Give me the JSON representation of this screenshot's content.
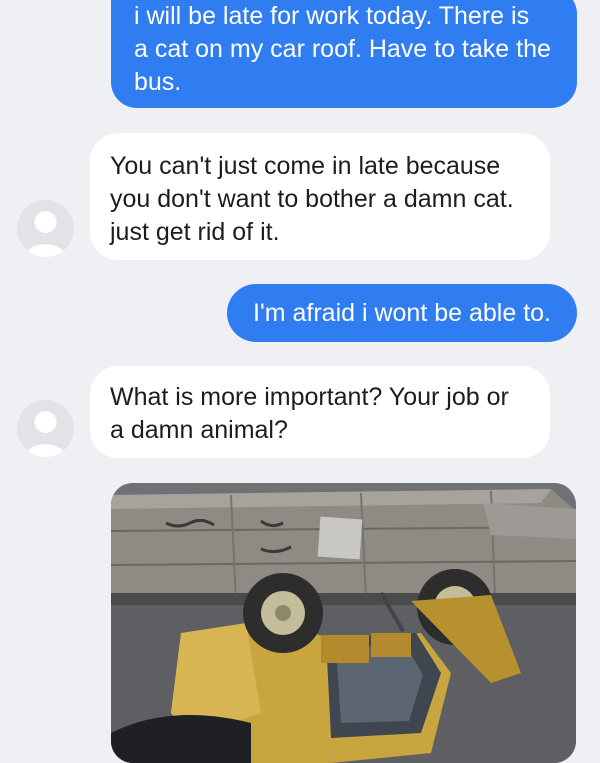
{
  "messages": [
    {
      "direction": "outgoing",
      "text": "i will be late for work today. There is\na cat on my car roof. Have to take the\nbus."
    },
    {
      "direction": "incoming",
      "text": "You can't just come in late because\nyou don't want to bother a damn cat.\njust get rid of it.",
      "avatar": "user-avatar-icon"
    },
    {
      "direction": "outgoing",
      "text": "I'm afraid i wont be able to."
    },
    {
      "direction": "incoming",
      "text": "What is more important? Your job or\na damn animal?",
      "avatar": "user-avatar-icon"
    },
    {
      "direction": "outgoing",
      "attachment": "photo"
    }
  ],
  "colors": {
    "background": "#eef0f4",
    "outgoing_bubble": "#2f7df1",
    "incoming_bubble": "#ffffff",
    "avatar_bg": "#e1e3e7",
    "avatar_fg": "#ffffff"
  }
}
